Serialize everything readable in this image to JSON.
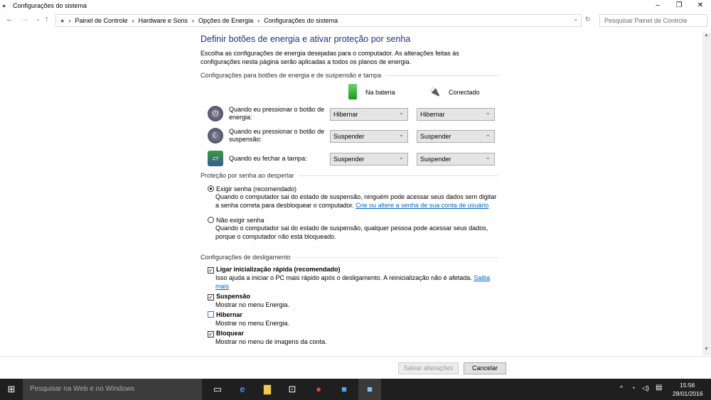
{
  "window": {
    "title": "Configurações do sistema"
  },
  "breadcrumb": [
    "Painel de Controle",
    "Hardware e Sons",
    "Opções de Energia",
    "Configurações do sistema"
  ],
  "search": {
    "placeholder": "Pesquisar Painel de Controle"
  },
  "main": {
    "title": "Definir botões de energia e ativar proteção por senha",
    "intro": "Escolha as configurações de energia desejadas para o computador. As alterações feitas às configurações nesta página serão aplicadas a todos os planos de energia.",
    "section_buttons": "Configurações para botões de energia e de suspensão e tampa",
    "col_battery": "Na bateria",
    "col_plugged": "Conectado",
    "rows": [
      {
        "label": "Quando eu pressionar o botão de energia:",
        "battery": "Hibernar",
        "plugged": "Hibernar"
      },
      {
        "label": "Quando eu pressionar o botão de suspensão:",
        "battery": "Suspender",
        "plugged": "Suspender"
      },
      {
        "label": "Quando eu fechar a tampa:",
        "battery": "Suspender",
        "plugged": "Suspender"
      }
    ],
    "section_password": "Proteção por senha ao despertar",
    "opt_require": "Exigir senha (recomendado)",
    "opt_require_desc": "Quando o computador sai do estado de suspensão, ninguém pode acessar seus dados sem digitar a senha correta para desbloquear o computador.",
    "opt_require_link": "Crie ou altere a senha de sua conta de usuário",
    "opt_norequire": "Não exigir senha",
    "opt_norequire_desc": "Quando o computador sai do estado de suspensão, qualquer pessoa pode acessar seus dados, porque o computador não está bloqueado.",
    "section_shutdown": "Configurações de desligamento",
    "fast_startup": "Ligar inicialização rápida (recomendado)",
    "fast_startup_desc": "Isso ajuda a iniciar o PC mais rápido após o desligamento. A reinicialização não é afetada.",
    "fast_startup_link": "Saiba mais",
    "sleep": "Suspensão",
    "sleep_desc": "Mostrar no menu Energia.",
    "hibernate": "Hibernar",
    "hibernate_desc": "Mostrar no menu Energia.",
    "lock": "Bloquear",
    "lock_desc": "Mostrar no menu de imagens da conta."
  },
  "buttons": {
    "save": "Salvar alterações",
    "cancel": "Cancelar"
  },
  "taskbar": {
    "search": "Pesquisar na Web e no Windows",
    "time": "15:56",
    "date": "28/01/2016"
  }
}
